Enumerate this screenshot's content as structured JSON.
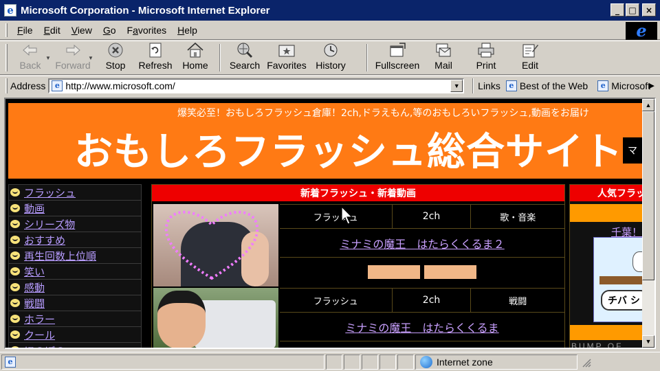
{
  "window": {
    "title": "Microsoft Corporation - Microsoft Internet Explorer",
    "ie_letter": "e",
    "minimize": "_",
    "maximize": "□",
    "close": "×"
  },
  "menubar": {
    "items": [
      {
        "label": "File",
        "underline": "F",
        "rest": "ile"
      },
      {
        "label": "Edit",
        "underline": "E",
        "rest": "dit"
      },
      {
        "label": "View",
        "underline": "V",
        "rest": "iew"
      },
      {
        "label": "Go",
        "underline": "G",
        "rest": "o"
      },
      {
        "label": "Favorites",
        "underline": "a",
        "pre": "F",
        "rest": "vorites"
      },
      {
        "label": "Help",
        "underline": "H",
        "rest": "elp"
      }
    ]
  },
  "toolbar": {
    "back": "Back",
    "forward": "Forward",
    "stop": "Stop",
    "refresh": "Refresh",
    "home": "Home",
    "search": "Search",
    "favorites": "Favorites",
    "history": "History",
    "fullscreen": "Fullscreen",
    "mail": "Mail",
    "print": "Print",
    "edit": "Edit"
  },
  "address": {
    "label": "Address",
    "url": "http://www.microsoft.com/",
    "links_label": "Links",
    "links": [
      "Best of the Web",
      "Microsoft"
    ]
  },
  "page": {
    "banner_sub": "爆笑必至！おもしろフラッシュ倉庫！2ch,ドラえもん,等のおもしろいフラッシュ,動画をお届け",
    "banner_title": "おもしろフラッシュ総合サイト",
    "banner_corner": "マ",
    "nav": [
      "フラッシュ",
      "動画",
      "シリーズ物",
      "おすすめ",
      "再生回数上位順",
      "笑い",
      "感動",
      "戦闘",
      "ホラー",
      "クール",
      "ほのぼの"
    ],
    "center_heading": "新着フラッシュ・新着動画",
    "entries": [
      {
        "type": "フラッシュ",
        "source": "2ch",
        "genre": "歌・音楽",
        "title": "ミナミの魔王　はたらくくるま２"
      },
      {
        "type": "フラッシュ",
        "source": "2ch",
        "genre": "戦闘",
        "title": "ミナミの魔王　はたらくくるま"
      }
    ],
    "right_heading": "人気フラッシュ",
    "right_link": "千葉！泣",
    "right_bubble": "チバ シ",
    "right_bottom": "BUMP OF"
  },
  "status": {
    "main": "",
    "zone": "Internet zone"
  }
}
